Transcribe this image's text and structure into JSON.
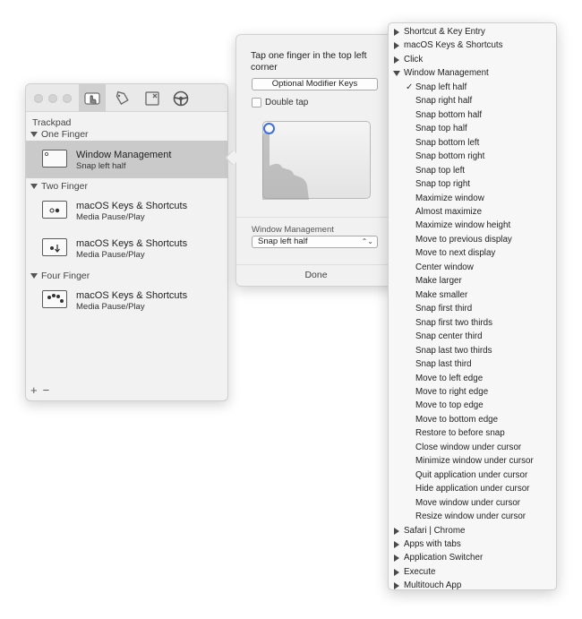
{
  "main_window": {
    "section_title": "Trackpad",
    "groups": [
      {
        "label": "One Finger",
        "rows": [
          {
            "title": "Window Management",
            "subtitle": "Snap left half",
            "selected": true,
            "icon": "one-finger-window-icon"
          }
        ]
      },
      {
        "label": "Two Finger",
        "rows": [
          {
            "title": "macOS Keys & Shortcuts",
            "subtitle": "Media Pause/Play",
            "selected": false,
            "icon": "two-finger-tap-icon"
          },
          {
            "title": "macOS Keys & Shortcuts",
            "subtitle": "Media Pause/Play",
            "selected": false,
            "icon": "two-finger-swipe-down-icon"
          }
        ]
      },
      {
        "label": "Four Finger",
        "rows": [
          {
            "title": "macOS Keys & Shortcuts",
            "subtitle": "Media Pause/Play",
            "selected": false,
            "icon": "four-finger-tap-icon"
          }
        ]
      }
    ],
    "add_label": "+",
    "remove_label": "−",
    "toolbar_icons": [
      "trackpad-gesture-icon",
      "tag-icon",
      "window-close-icon",
      "steering-wheel-icon"
    ]
  },
  "popover": {
    "title": "Tap one finger in the top left corner",
    "modifier_button": "Optional Modifier Keys",
    "double_tap_label": "Double tap",
    "double_tap_checked": false,
    "action_category_label": "Window Management",
    "action_value": "Snap left half",
    "select_arrows": "⌃⌄",
    "done_label": "Done"
  },
  "menu": {
    "checkmark": "✓",
    "items": [
      {
        "label": "Shortcut & Key Entry",
        "kind": "top",
        "expanded": false
      },
      {
        "label": "macOS Keys & Shortcuts",
        "kind": "top",
        "expanded": false
      },
      {
        "label": "Click",
        "kind": "top",
        "expanded": false
      },
      {
        "label": "Window Management",
        "kind": "top",
        "expanded": true
      },
      {
        "label": "Snap left half",
        "kind": "sub",
        "checked": true
      },
      {
        "label": "Snap right half",
        "kind": "sub"
      },
      {
        "label": "Snap bottom half",
        "kind": "sub"
      },
      {
        "label": "Snap top half",
        "kind": "sub"
      },
      {
        "label": "Snap bottom left",
        "kind": "sub"
      },
      {
        "label": "Snap bottom right",
        "kind": "sub"
      },
      {
        "label": "Snap top left",
        "kind": "sub"
      },
      {
        "label": "Snap top right",
        "kind": "sub"
      },
      {
        "label": "Maximize window",
        "kind": "sub"
      },
      {
        "label": "Almost maximize",
        "kind": "sub"
      },
      {
        "label": "Maximize window height",
        "kind": "sub"
      },
      {
        "label": "Move to previous display",
        "kind": "sub"
      },
      {
        "label": "Move to next display",
        "kind": "sub"
      },
      {
        "label": "Center window",
        "kind": "sub"
      },
      {
        "label": "Make larger",
        "kind": "sub"
      },
      {
        "label": "Make smaller",
        "kind": "sub"
      },
      {
        "label": "Snap first third",
        "kind": "sub"
      },
      {
        "label": "Snap first two thirds",
        "kind": "sub"
      },
      {
        "label": "Snap center third",
        "kind": "sub"
      },
      {
        "label": "Snap last two thirds",
        "kind": "sub"
      },
      {
        "label": "Snap last third",
        "kind": "sub"
      },
      {
        "label": "Move to left edge",
        "kind": "sub"
      },
      {
        "label": "Move to right edge",
        "kind": "sub"
      },
      {
        "label": "Move to top edge",
        "kind": "sub"
      },
      {
        "label": "Move to bottom edge",
        "kind": "sub"
      },
      {
        "label": "Restore to before snap",
        "kind": "sub"
      },
      {
        "label": "Close window under cursor",
        "kind": "sub"
      },
      {
        "label": "Minimize window under cursor",
        "kind": "sub"
      },
      {
        "label": "Quit application under cursor",
        "kind": "sub"
      },
      {
        "label": "Hide application under cursor",
        "kind": "sub"
      },
      {
        "label": "Move window under cursor",
        "kind": "sub"
      },
      {
        "label": "Resize window under cursor",
        "kind": "sub"
      },
      {
        "label": "Safari | Chrome",
        "kind": "top",
        "expanded": false
      },
      {
        "label": "Apps with tabs",
        "kind": "top",
        "expanded": false
      },
      {
        "label": "Application Switcher",
        "kind": "top",
        "expanded": false
      },
      {
        "label": "Execute",
        "kind": "top",
        "expanded": false
      },
      {
        "label": "Multitouch App",
        "kind": "top",
        "expanded": false
      }
    ]
  },
  "colors": {
    "accent": "#3f6fd8",
    "selection": "#cacaca"
  }
}
